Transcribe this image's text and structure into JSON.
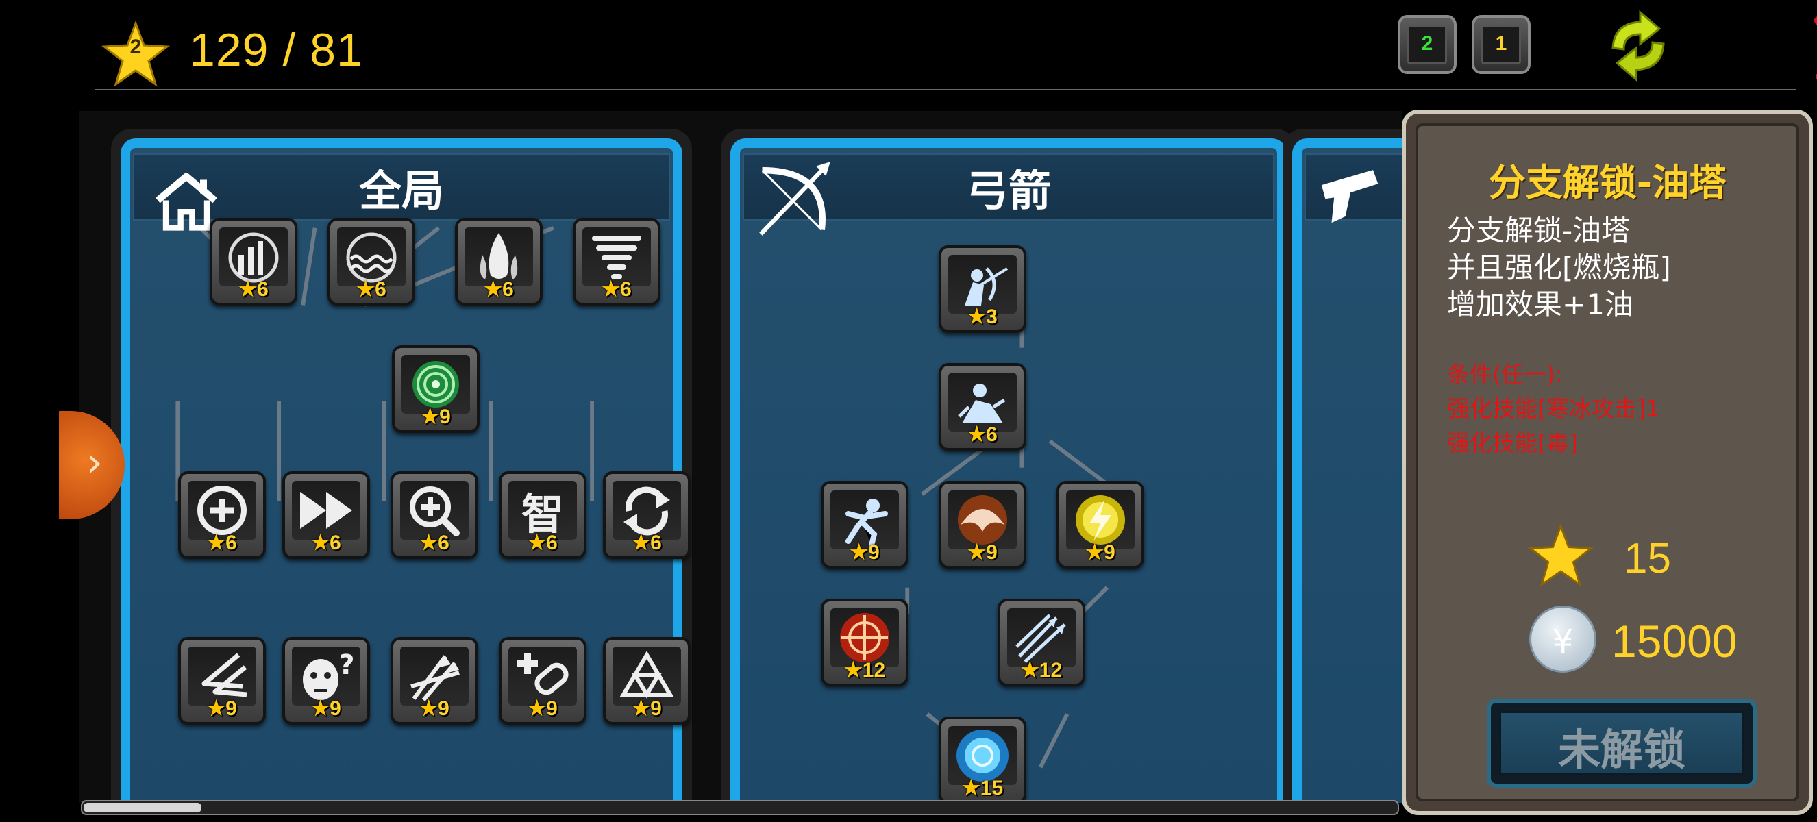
{
  "header": {
    "level_badge": "2",
    "score": "129 / 81",
    "page_buttons": [
      {
        "label": "2",
        "color": "#3adf3a"
      },
      {
        "label": "1",
        "color": "#ffd22a"
      }
    ],
    "refresh_icon": "refresh-arrows-icon",
    "close_icon": "close-x-icon"
  },
  "side_tab": {
    "label": "›"
  },
  "columns": [
    {
      "title": "全局",
      "icon": "house-icon",
      "nodes": [
        {
          "icon": "wind-bars-icon",
          "cost": "6"
        },
        {
          "icon": "water-wave-icon",
          "cost": "6"
        },
        {
          "icon": "flame-drops-icon",
          "cost": "6"
        },
        {
          "icon": "tornado-icon",
          "cost": "6"
        },
        {
          "icon": "green-target-icon",
          "cost": "9"
        },
        {
          "icon": "plus-circle-icon",
          "cost": "6"
        },
        {
          "icon": "fast-forward-icon",
          "cost": "6"
        },
        {
          "icon": "zoom-plus-icon",
          "cost": "6"
        },
        {
          "icon": "wisdom-glyph-icon",
          "cost": "6"
        },
        {
          "icon": "cycle-arrows-icon",
          "cost": "6"
        },
        {
          "icon": "claw-slash-icon",
          "cost": "9"
        },
        {
          "icon": "confused-face-icon",
          "cost": "9"
        },
        {
          "icon": "multi-arrow-icon",
          "cost": "9"
        },
        {
          "icon": "heal-bandage-icon",
          "cost": "9"
        },
        {
          "icon": "triangle-knot-icon",
          "cost": "9"
        }
      ]
    },
    {
      "title": "弓箭",
      "icon": "bow-arrow-icon",
      "nodes": [
        {
          "icon": "archer-shoot-icon",
          "cost": "3"
        },
        {
          "icon": "archer-crouch-icon",
          "cost": "6"
        },
        {
          "icon": "running-archer-icon",
          "cost": "9"
        },
        {
          "icon": "fire-dome-icon",
          "cost": "9"
        },
        {
          "icon": "lightning-orb-icon",
          "cost": "9"
        },
        {
          "icon": "crosshair-fire-icon",
          "cost": "12"
        },
        {
          "icon": "triple-arrow-icon",
          "cost": "12"
        },
        {
          "icon": "blue-burst-icon",
          "cost": "15"
        }
      ]
    },
    {
      "title": "",
      "icon": "pistol-icon",
      "nodes": []
    }
  ],
  "info": {
    "title": "分支解锁-油塔",
    "desc_lines": [
      "分支解锁-油塔",
      "并且强化[燃烧瓶]",
      "增加效果+1油"
    ],
    "cond_lines": [
      "条件(任一):",
      "强化技能[寒冰攻击]1",
      "强化技能[毒]"
    ],
    "star_cost": "15",
    "coin_symbol": "¥",
    "coin_cost": "15000",
    "button_label": "未解锁"
  },
  "scroll": {
    "position_fraction": 0.09
  }
}
